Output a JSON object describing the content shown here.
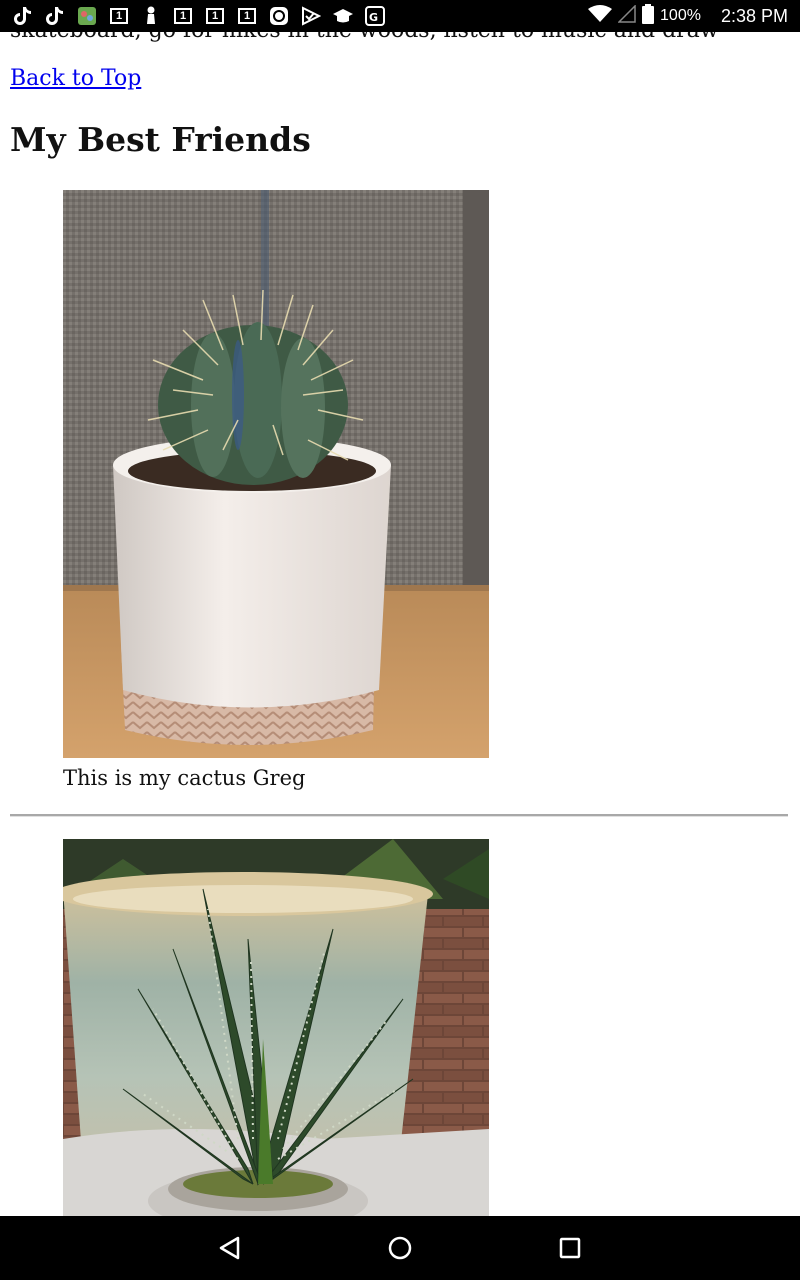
{
  "status_bar": {
    "left_icons": [
      "tiktok-icon",
      "tiktok-icon",
      "game-app-icon",
      "notification-1-icon",
      "chess-pawn-icon",
      "notification-1-icon",
      "notification-1-icon",
      "notification-1-icon",
      "sync-app-icon",
      "check-app-icon",
      "graduation-cap-icon",
      "maps-icon"
    ],
    "badge_number": "1",
    "battery": "100%",
    "time": "2:38 PM"
  },
  "page": {
    "cut_off_text": "skateboard, go for hikes in the woods, listen to music and draw",
    "back_link": "Back to Top",
    "section_title": "My Best Friends",
    "friends": [
      {
        "caption": "This is my cactus Greg",
        "image": "cactus-photo"
      },
      {
        "caption": "",
        "image": "aloe-succulent-photo"
      }
    ]
  },
  "nav_bar": {
    "buttons": [
      "back-icon",
      "home-icon",
      "recents-icon"
    ]
  },
  "colors": {
    "link": "#0000ee",
    "bars": "#000000",
    "divider": "#a8a8a8"
  }
}
